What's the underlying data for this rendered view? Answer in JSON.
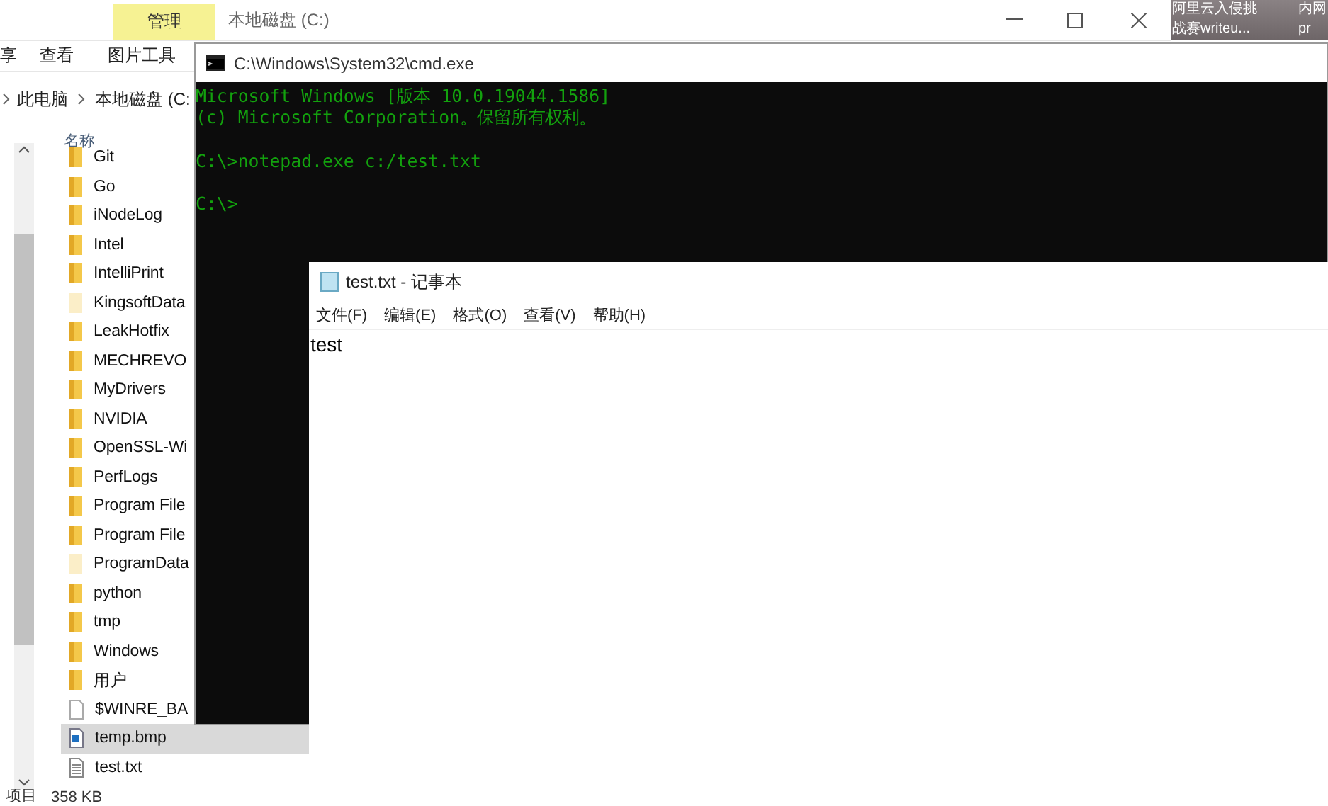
{
  "explorer": {
    "context_tab": "管理",
    "title": "本地磁盘 (C:)",
    "ribbon_tabs": [
      "享",
      "查看",
      "图片工具"
    ],
    "breadcrumb": [
      "此电脑",
      "本地磁盘 (C:"
    ],
    "column_header": "名称",
    "files": [
      {
        "name": "Git",
        "kind": "folder",
        "selected": false
      },
      {
        "name": "Go",
        "kind": "folder",
        "selected": false
      },
      {
        "name": "iNodeLog",
        "kind": "folder",
        "selected": false
      },
      {
        "name": "Intel",
        "kind": "folder",
        "selected": false
      },
      {
        "name": "IntelliPrint",
        "kind": "folder",
        "selected": false
      },
      {
        "name": "KingsoftData",
        "kind": "hidden-folder",
        "selected": false
      },
      {
        "name": "LeakHotfix",
        "kind": "folder",
        "selected": false
      },
      {
        "name": "MECHREVO",
        "kind": "folder",
        "selected": false
      },
      {
        "name": "MyDrivers",
        "kind": "folder",
        "selected": false
      },
      {
        "name": "NVIDIA",
        "kind": "folder",
        "selected": false
      },
      {
        "name": "OpenSSL-Wi",
        "kind": "folder",
        "selected": false
      },
      {
        "name": "PerfLogs",
        "kind": "folder",
        "selected": false
      },
      {
        "name": "Program File",
        "kind": "folder",
        "selected": false
      },
      {
        "name": "Program File",
        "kind": "folder",
        "selected": false
      },
      {
        "name": "ProgramData",
        "kind": "hidden-folder",
        "selected": false
      },
      {
        "name": "python",
        "kind": "folder",
        "selected": false
      },
      {
        "name": "tmp",
        "kind": "folder",
        "selected": false
      },
      {
        "name": "Windows",
        "kind": "folder",
        "selected": false
      },
      {
        "name": "用户",
        "kind": "folder",
        "selected": false
      },
      {
        "name": "$WINRE_BA",
        "kind": "file",
        "selected": false
      },
      {
        "name": "temp.bmp",
        "kind": "image",
        "selected": true
      },
      {
        "name": "test.txt",
        "kind": "text",
        "selected": false
      }
    ],
    "status_bar": [
      "项目",
      "358 KB"
    ]
  },
  "desktop_labels": [
    "阿里云入侵挑",
    "内网",
    "战赛writeu...",
    "pr"
  ],
  "cmd": {
    "title": "C:\\Windows\\System32\\cmd.exe",
    "lines": [
      {
        "text": "Microsoft Windows [版本 10.0.19044.1586]",
        "blank_before": false
      },
      {
        "text": "(c) Microsoft Corporation。保留所有权利。",
        "blank_before": false
      },
      {
        "text": "C:\\>notepad.exe c:/test.txt",
        "blank_before": true
      },
      {
        "text": "C:\\>",
        "blank_before": true
      }
    ]
  },
  "notepad": {
    "title": "test.txt - 记事本",
    "menu": [
      "文件(F)",
      "编辑(E)",
      "格式(O)",
      "查看(V)",
      "帮助(H)"
    ],
    "content": "test"
  }
}
